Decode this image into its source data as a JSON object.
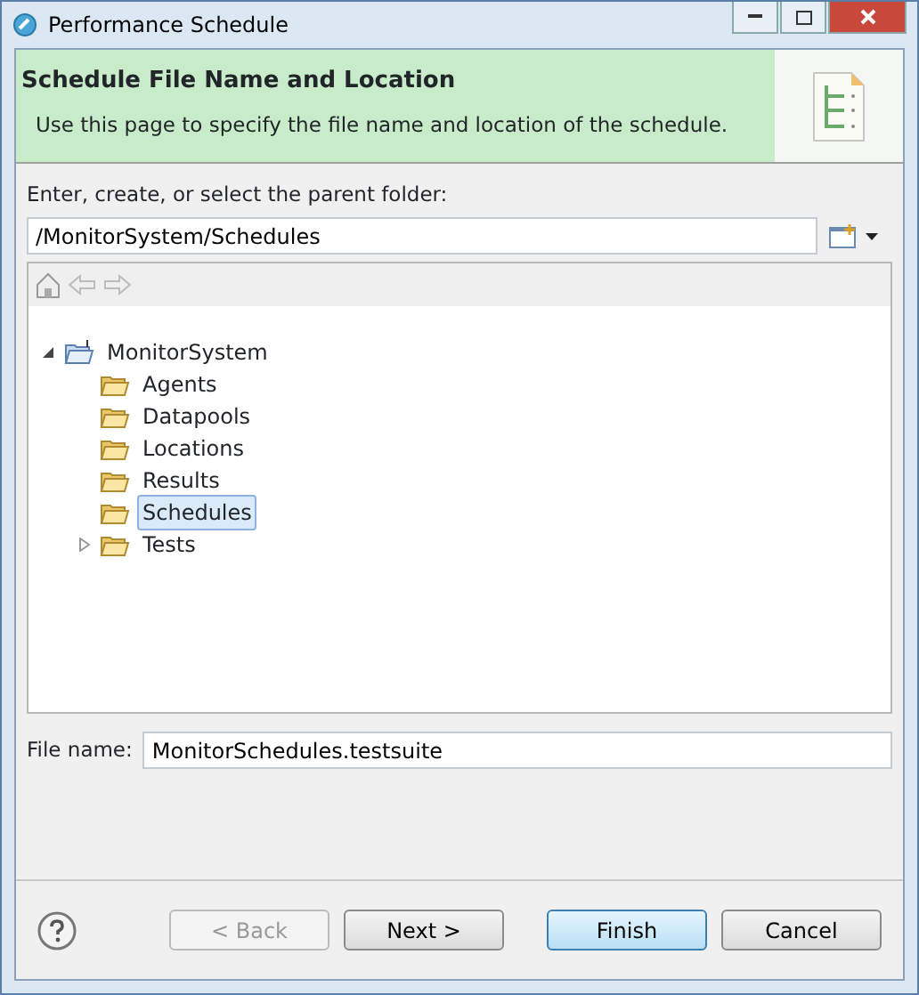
{
  "window": {
    "title": "Performance Schedule"
  },
  "header": {
    "title": "Schedule File Name and Location",
    "description": "Use this page to specify the file name and location of the schedule."
  },
  "folder": {
    "label": "Enter, create, or select the parent folder:",
    "value": "/MonitorSystem/Schedules"
  },
  "tree": [
    {
      "label": "MonitorSystem",
      "kind": "project",
      "expanded": true,
      "selected": false,
      "children": [
        {
          "label": "Agents",
          "kind": "folder",
          "selected": false
        },
        {
          "label": "Datapools",
          "kind": "folder",
          "selected": false
        },
        {
          "label": "Locations",
          "kind": "folder",
          "selected": false
        },
        {
          "label": "Results",
          "kind": "folder",
          "selected": false
        },
        {
          "label": "Schedules",
          "kind": "folder",
          "selected": true
        },
        {
          "label": "Tests",
          "kind": "folder",
          "expanded": false,
          "selected": false
        }
      ]
    }
  ],
  "file_name": {
    "label": "File name:",
    "value": "MonitorSchedules.testsuite"
  },
  "buttons": [
    {
      "label": "< Back",
      "disabled": true,
      "default": false
    },
    {
      "label": "Next >",
      "disabled": false,
      "default": false
    },
    {
      "label": "Finish",
      "disabled": false,
      "default": true
    },
    {
      "label": "Cancel",
      "disabled": false,
      "default": false
    }
  ]
}
